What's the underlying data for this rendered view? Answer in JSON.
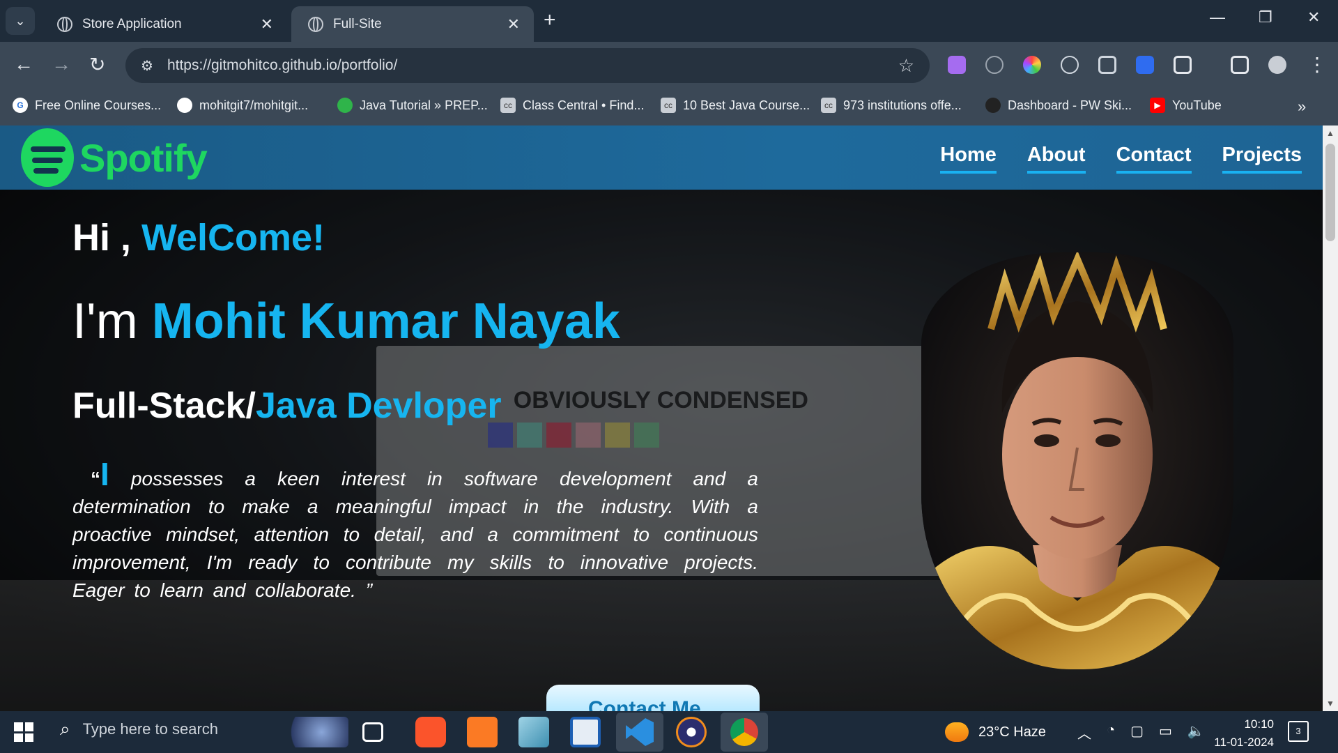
{
  "browser": {
    "tabs": [
      {
        "title": "Store Application"
      },
      {
        "title": "Full-Site"
      }
    ],
    "new_tab": "+",
    "url": "https://gitmohitco.github.io/portfolio/",
    "bookmarks": [
      "Free Online Courses...",
      "mohitgit7/mohitgit...",
      "Java Tutorial » PREP...",
      "Class Central • Find...",
      "10 Best Java Course...",
      "973 institutions offe...",
      "Dashboard - PW Ski...",
      "YouTube"
    ]
  },
  "site": {
    "brand": "Spotify",
    "brand_color": "#1ed760",
    "accent_color": "#16b5f0",
    "nav": [
      "Home",
      "About",
      "Contact",
      "Projects"
    ],
    "greeting_prefix": "Hi ,",
    "greeting_accent": "WelCome!",
    "intro_prefix": "I'm",
    "name": "Mohit Kumar Nayak",
    "role_prefix": "Full-Stack/",
    "role_accent": "Java Devloper",
    "quote_open": "“",
    "quote_first": "I",
    "quote_body": " possesses a keen interest in software development and a determination to make a meaningful impact in the industry. With a proactive mindset, attention to detail, and a commitment to continuous improvement, I'm ready to contribute my skills to innovative projects. Eager to learn and collaborate. ”",
    "background_text": "OBVIOUSLY CONDENSED",
    "contact_button": "Contact Me"
  },
  "taskbar": {
    "search_placeholder": "Type here to search",
    "weather": "23°C  Haze",
    "time": "10:10",
    "date": "11-01-2024",
    "notifications": "3"
  }
}
